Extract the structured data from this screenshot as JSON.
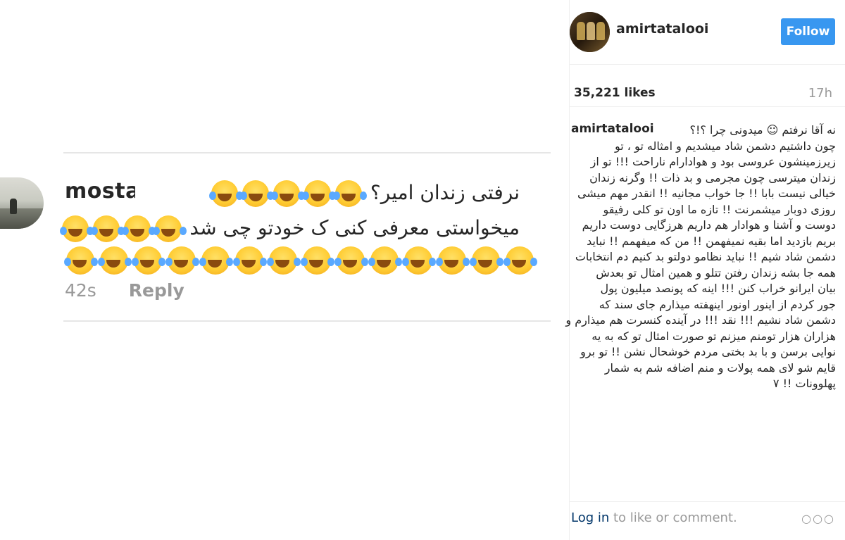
{
  "comment": {
    "username": "mostafa",
    "line1_text": "نرفتی زندان امیر؟",
    "line2_text": "میخواستی معرفی کنی ک خودتو چی شد",
    "line1_emoji_count": 5,
    "line2_emoji_count": 4,
    "line3_emoji_count": 14,
    "time": "42s",
    "reply_label": "Reply"
  },
  "post": {
    "username": "amirtatalooi",
    "follow_label": "Follow",
    "likes": "35,221 likes",
    "age": "17h",
    "caption_username": "amirtatalooi",
    "caption_lines": [
      "نه آقا نرفتم ☺ میدونی چرا ؟!؟",
      "چون داشتیم دشمن شاد میشدیم و امثاله تو ، تو",
      "زیرزمینشون عروسی بود و هوادارام ناراحت !!! تو از",
      "زندان میترسی چون مجرمی و بد ذات !! وگرنه زندان",
      "خیالی نیست بابا !! جا خواب مجانیه !! انقدر مهم میشی",
      "روزی دوبار میشمرنت !! تازه ما اون تو کلی رفیقو",
      "دوست و آشنا و هوادار هم داریم هرزگایی دوست داریم",
      "بریم بازدید اما بقیه نمیفهمن !! من که میفهمم !! نباید",
      "دشمن شاد شیم !! نباید نظامو دولتو بد کنیم دم انتخابات",
      "همه جا بشه زندان رفتن تتلو و همین امثال تو بعدش",
      "بیان ایرانو خراب کنن !!! اینه که پونصد میلیون پول",
      "جور کردم از اینور اونور اینهفته میذارم جای سند که",
      "دشمن شاد نشیم !!! نقد !!! در آینده کنسرت هم میذارم و",
      "هزاران هزار تومنم میزنم تو صورت امثال تو که به یه",
      "نوایی برسن و با بد بختی مردم خوشحال نشن !! تو برو",
      "قایم شو لای همه پولات و منم اضافه شم به شمار",
      "پهلوونات !! ۷"
    ],
    "login_link": "Log in",
    "login_rest": " to like or comment.",
    "more": "○○○"
  },
  "colors": {
    "follow_bg": "#3897f0",
    "muted": "#999999",
    "text": "#262626",
    "link": "#003569"
  },
  "icons": {
    "emoji": "face-with-tears-of-joy-icon",
    "more": "more-options-icon"
  }
}
